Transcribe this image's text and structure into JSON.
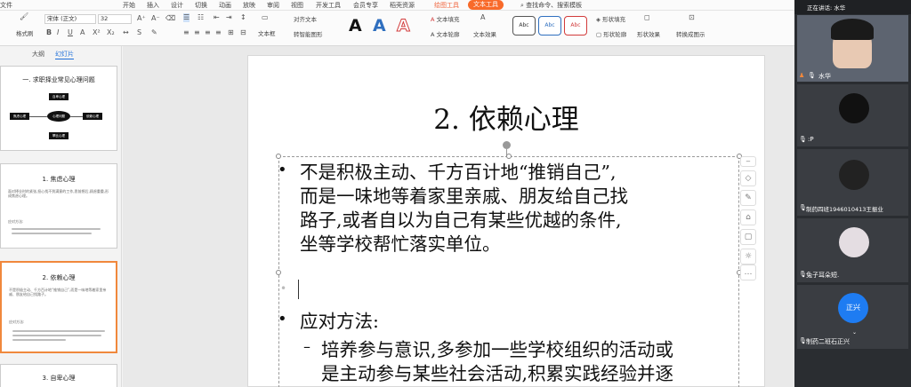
{
  "menubar": {
    "file": "文件",
    "tabs": [
      "开始",
      "插入",
      "设计",
      "切换",
      "动画",
      "放映",
      "审阅",
      "视图",
      "开发工具",
      "会员专享",
      "稻壳资源"
    ],
    "drawing_tools": "绘图工具",
    "text_tools": "文本工具",
    "search": "查找命令、搜索模板"
  },
  "ribbon": {
    "format_painter": "格式刷",
    "font_name": "宋体 (正文)",
    "font_size": "32",
    "text_box": "文本框",
    "align_text": "对齐文本",
    "convert_smartart": "转智能图形",
    "text_fill": "文本填充",
    "text_outline": "文本轮廓",
    "text_effect": "文本效果",
    "style_abc": "Abc",
    "shape_fill": "形状填充",
    "shape_outline": "形状轮廓",
    "shape_effect": "形状效果",
    "convert_art": "转换成图示"
  },
  "panel": {
    "tab_outline": "大纲",
    "tab_slides": "幻灯片"
  },
  "thumbnails": [
    {
      "num": "",
      "title": "一. 求职择业常见心理问题",
      "mind_center": "心理问题",
      "mind_nodes": [
        "焦虑心理",
        "依赖心理",
        "自卑心理",
        "攀比心理"
      ]
    },
    {
      "num": "",
      "title": "1. 焦虑心理",
      "body": "面对择业时的紧张,担心找不到满意的工作,思前想后,顾虑重重,形成焦虑心理。",
      "sub": "应对方法:"
    },
    {
      "num": "",
      "title": "2. 依赖心理",
      "body": "不是积极主动、千方百计地“推销自己”,而是一味地等着家里亲戚、朋友给自己找路子。",
      "sub": "应对方法:"
    },
    {
      "num": "",
      "title": "3. 自卑心理"
    }
  ],
  "slide": {
    "title": "2. 依赖心理",
    "bullet1_lines": [
      "不是积极主动、千方百计地“推销自己”,",
      "而是一味地等着家里亲戚、朋友给自己找",
      "路子,或者自以为自己有某些优越的条件,",
      "坐等学校帮忙落实单位。"
    ],
    "bullet2": "应对方法:",
    "sub_lines": [
      "培养参与意识,多参加一些学校组织的活动或",
      "是主动参与某些社会活动,积累实践经验并逐"
    ]
  },
  "meeting": {
    "speaking": "正在讲话: 水华",
    "participants": [
      {
        "name": "水华"
      },
      {
        "name": ":P"
      },
      {
        "name": "制药四班1946010413王振业"
      },
      {
        "name": "兔子耳朵短."
      },
      {
        "name": "制药二班石正兴"
      }
    ],
    "join_label": "正兴"
  },
  "colors": {
    "accent_orange": "#f86a2a",
    "accent_blue": "#1e7cf2",
    "meeting_bg": "#2a2d31"
  }
}
